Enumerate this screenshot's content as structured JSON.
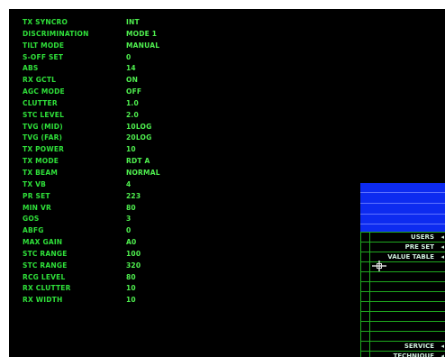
{
  "parameters": [
    {
      "label": "TX SYNCRO",
      "value": "INT"
    },
    {
      "label": "DISCRIMINATION",
      "value": "MODE 1"
    },
    {
      "label": "TILT MODE",
      "value": "MANUAL"
    },
    {
      "label": "S-OFF SET",
      "value": "0"
    },
    {
      "label": "ABS",
      "value": "14"
    },
    {
      "label": "RX GCTL",
      "value": "ON"
    },
    {
      "label": "AGC MODE",
      "value": "OFF"
    },
    {
      "label": "CLUTTER",
      "value": "1.0"
    },
    {
      "label": "STC LEVEL",
      "value": "2.0"
    },
    {
      "label": "TVG (MID)",
      "value": "10LOG"
    },
    {
      "label": "TVG (FAR)",
      "value": "20LOG"
    },
    {
      "label": "TX POWER",
      "value": "10"
    },
    {
      "label": "TX MODE",
      "value": "RDT A"
    },
    {
      "label": "TX BEAM",
      "value": "NORMAL"
    },
    {
      "label": "TX VB",
      "value": "4"
    },
    {
      "label": "PR SET",
      "value": "223"
    },
    {
      "label": "MIN VR",
      "value": "80"
    },
    {
      "label": "GOS",
      "value": "3"
    },
    {
      "label": "ABFG",
      "value": "0"
    },
    {
      "label": "MAX GAIN",
      "value": "A0"
    },
    {
      "label": "STC RANGE",
      "value": "100"
    },
    {
      "label": "STC RANGE",
      "value": "320"
    },
    {
      "label": "RCG LEVEL",
      "value": "80"
    },
    {
      "label": "RX CLUTTER",
      "value": "10"
    },
    {
      "label": "RX WIDTH",
      "value": "10"
    }
  ],
  "menu": {
    "top_items": [
      "USERS",
      "PRE SET",
      "VALUE TABLE"
    ],
    "bottom_items": [
      "SERVICE",
      "TECHNIQUE"
    ],
    "arrow_icon": "arrow-left-icon"
  },
  "colors": {
    "background": "#000000",
    "label_green": "#2fe03a",
    "value_green": "#4ff04f",
    "menu_text": "#cfeedd",
    "panel_blue": "#0d2bf0",
    "panel_line": "#1fa81f"
  }
}
